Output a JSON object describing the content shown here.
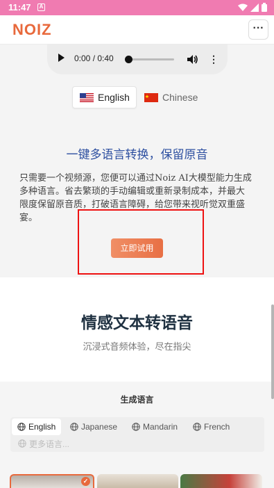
{
  "status_bar": {
    "time": "11:47",
    "notification_icon": "A"
  },
  "header": {
    "logo": "NOIZ",
    "menu_label": "···"
  },
  "audio_player": {
    "time": "0:00 / 0:40",
    "progress": 0
  },
  "language_switch": {
    "options": [
      {
        "label": "English",
        "flag": "us-flag",
        "selected": true
      },
      {
        "label": "Chinese",
        "flag": "cn-flag",
        "selected": false
      }
    ]
  },
  "feature": {
    "headline": "一键多语言转换，保留原音",
    "description": "只需要一个视频源，您便可以通过Noiz AI大模型能力生成多种语言。省去繁琐的手动编辑或重新录制成本，并最大限度保留原音质，打破语言障碍，给您带来视听觉双重盛宴。",
    "cta_label": "立即试用"
  },
  "section": {
    "title": "情感文本转语音",
    "subtitle": "沉浸式音频体验，尽在指尖"
  },
  "generate": {
    "title": "生成语言",
    "tags": [
      {
        "label": "English",
        "active": true
      },
      {
        "label": "Japanese",
        "active": false
      },
      {
        "label": "Mandarin",
        "active": false
      },
      {
        "label": "French",
        "active": false
      }
    ],
    "more_label": "更多语言..."
  },
  "colors": {
    "accent": "#e8693c",
    "headline_blue": "#2d4fa0",
    "status_bar": "#f07bb1",
    "highlight": "#ee1111"
  }
}
